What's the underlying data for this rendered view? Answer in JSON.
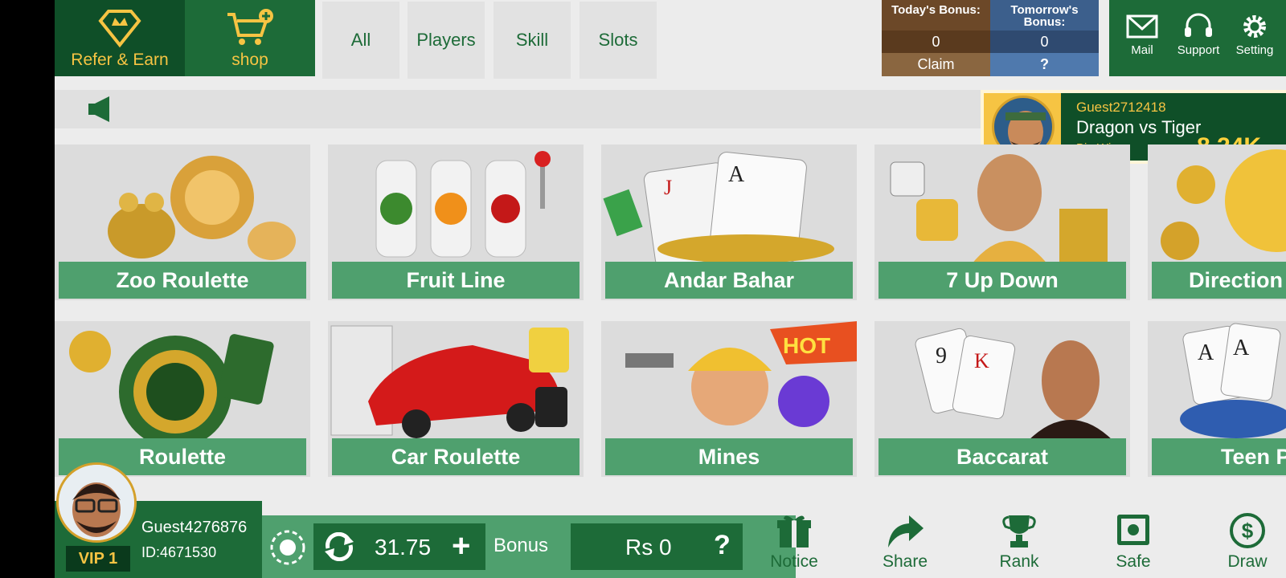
{
  "colors": {
    "primary_dark": "#0f4f28",
    "primary": "#1d6b38",
    "card_label": "#4fa06e",
    "gold": "#f6c443",
    "background": "#ececec"
  },
  "header": {
    "refer_label": "Refer & Earn",
    "shop_label": "shop",
    "tabs": [
      {
        "label": "All",
        "active": true
      },
      {
        "label": "Players",
        "active": false
      },
      {
        "label": "Skill",
        "active": false
      },
      {
        "label": "Slots",
        "active": false
      }
    ],
    "bonus": {
      "today_label": "Today's Bonus:",
      "today_value": "0",
      "claim_label": "Claim",
      "tomorrow_label": "Tomorrow's Bonus:",
      "tomorrow_value": "0",
      "tomorrow_action": "?"
    },
    "utilities": [
      {
        "label": "Mail",
        "icon": "mail-icon"
      },
      {
        "label": "Support",
        "icon": "headset-icon"
      },
      {
        "label": "Setting",
        "icon": "gear-icon"
      }
    ]
  },
  "marquee": {
    "icon": "speaker-icon"
  },
  "winner": {
    "name": "Guest2712418",
    "game": "Dragon vs Tiger",
    "tag": "Big Win",
    "amount": "8.24K"
  },
  "games": [
    {
      "title": "Zoo Roulette",
      "art": "lion-frog"
    },
    {
      "title": "Fruit Line",
      "art": "slot-machine"
    },
    {
      "title": "Andar Bahar",
      "art": "playing-cards"
    },
    {
      "title": "7 Up Down",
      "art": "dice"
    },
    {
      "title": "Direction",
      "art": "coins"
    },
    {
      "title": "Roulette",
      "art": "roulette-wheel"
    },
    {
      "title": "Car Roulette",
      "art": "sports-car"
    },
    {
      "title": "Mines",
      "art": "miner-hot"
    },
    {
      "title": "Baccarat",
      "art": "cards-woman"
    },
    {
      "title": "Teen Patti",
      "art": "aces-chips"
    }
  ],
  "player": {
    "name": "Guest4276876",
    "id": "ID:4671530",
    "vip": "VIP 1",
    "balance": "31.75",
    "bonus_label": "Bonus",
    "bonus_value": "Rs 0",
    "bonus_help": "?"
  },
  "bottom_nav": [
    {
      "label": "Notice",
      "icon": "gift-icon"
    },
    {
      "label": "Share",
      "icon": "share-icon"
    },
    {
      "label": "Rank",
      "icon": "trophy-icon"
    },
    {
      "label": "Safe",
      "icon": "safe-icon"
    },
    {
      "label": "Draw",
      "icon": "dollar-icon"
    }
  ]
}
